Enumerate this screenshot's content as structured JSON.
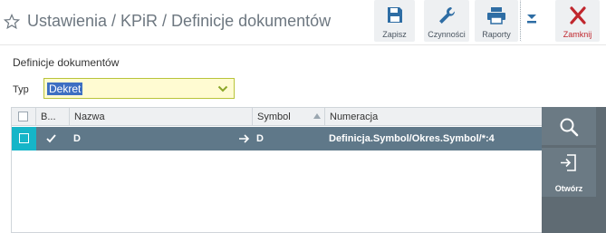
{
  "header": {
    "title": "Ustawienia / KPiR / Definicje dokumentów",
    "toolbar": {
      "save_label": "Zapisz",
      "actions_label": "Czynności",
      "reports_label": "Raporty",
      "close_label": "Zamknij"
    }
  },
  "form": {
    "section_title": "Definicje dokumentów",
    "type_label": "Typ",
    "type_value": "Dekret"
  },
  "grid": {
    "columns": [
      "B...",
      "Nazwa",
      "Symbol",
      "Numeracja"
    ],
    "rows": [
      {
        "b_checked": true,
        "nazwa": "D",
        "symbol": "D",
        "numeracja": "Definicja.Symbol/Okres.Symbol/*:4"
      }
    ]
  },
  "side": {
    "open_label": "Otwórz"
  },
  "colors": {
    "accent_cyan": "#16b5c8",
    "row_selected": "#5f7889",
    "close_red": "#c0262d"
  }
}
